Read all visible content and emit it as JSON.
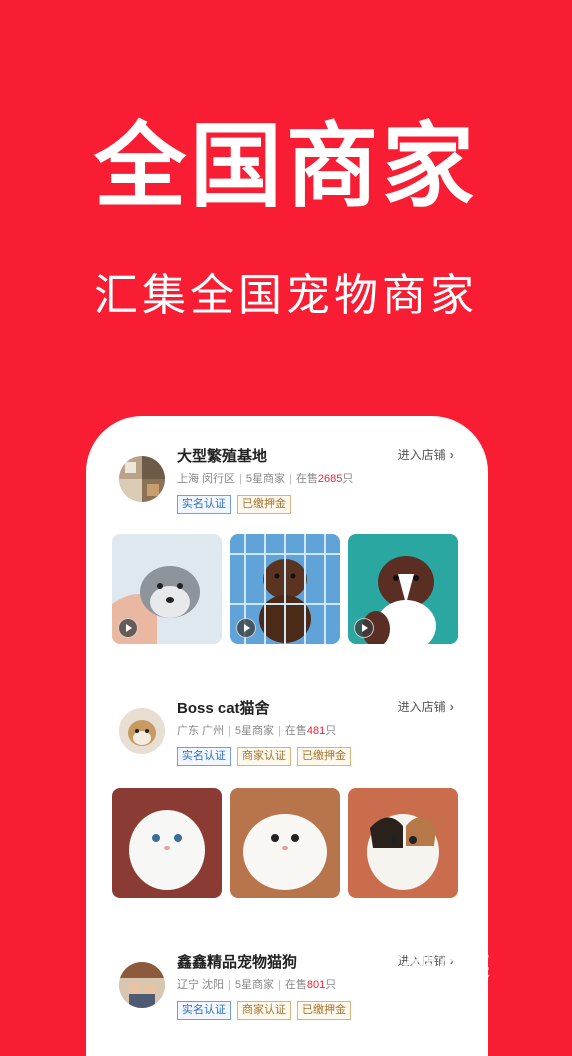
{
  "hero": {
    "title": "全国商家",
    "subtitle": "汇集全国宠物商家"
  },
  "shops": [
    {
      "name": "大型繁殖基地",
      "location": "上海 闵行区",
      "rating": "5星商家",
      "on_sale_prefix": "在售",
      "on_sale_count": "2685",
      "on_sale_suffix": "只",
      "enter_label": "进入店铺",
      "tags": [
        "实名认证",
        "已缴押金"
      ]
    },
    {
      "name": "Boss cat猫舍",
      "location": "广东 广州",
      "rating": "5星商家",
      "on_sale_prefix": "在售",
      "on_sale_count": "481",
      "on_sale_suffix": "只",
      "enter_label": "进入店铺",
      "tags": [
        "实名认证",
        "商家认证",
        "已缴押金"
      ]
    },
    {
      "name": "鑫鑫精品宠物猫狗",
      "location": "辽宁 沈阳",
      "rating": "5星商家",
      "on_sale_prefix": "在售",
      "on_sale_count": "801",
      "on_sale_suffix": "只",
      "enter_label": "进入店铺",
      "tags": [
        "实名认证",
        "商家认证",
        "已缴押金"
      ]
    }
  ],
  "watermark": {
    "text": "鲤豆荚"
  },
  "colors": {
    "brand_red": "#f81d33",
    "tag_blue": "#2f6fc4",
    "tag_brown": "#a77532"
  }
}
